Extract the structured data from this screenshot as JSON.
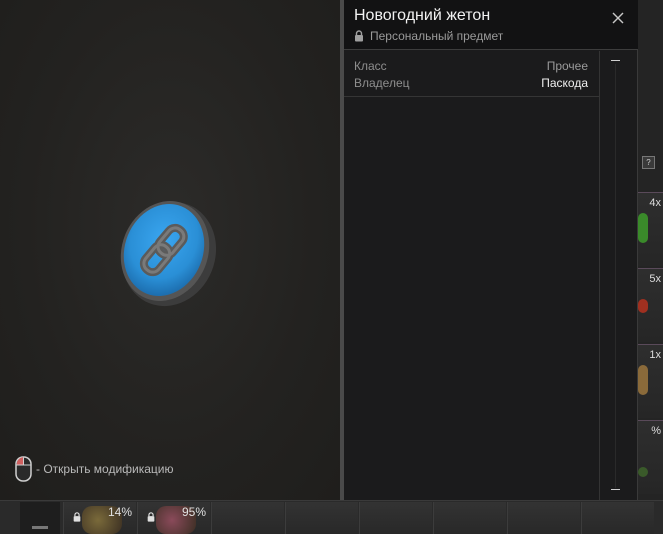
{
  "window": {
    "title": "Новогодний жетон",
    "subtitle": "Персональный предмет"
  },
  "properties": [
    {
      "key": "Класс",
      "value": "Прочее"
    },
    {
      "key": "Владелец",
      "value": "Паскода"
    }
  ],
  "preview": {
    "hint": "- Открыть модификацию",
    "token_color": "#2a8fd6",
    "icon": "chain-link-icon"
  },
  "background": {
    "right_counts": [
      "4x",
      "5x",
      "1x",
      "%"
    ],
    "right_colors": [
      "#3a8a2a",
      "#a03020",
      "#8a6a3a",
      "#3a5a2a"
    ],
    "help_label": "?",
    "bottom_slots": [
      {
        "percent": "14%",
        "color": "#7a6a3a"
      },
      {
        "percent": "95%",
        "color": "#8a4a5a"
      },
      {
        "percent": ""
      },
      {
        "percent": ""
      },
      {
        "percent": ""
      },
      {
        "percent": ""
      },
      {
        "percent": ""
      },
      {
        "percent": ""
      }
    ]
  }
}
